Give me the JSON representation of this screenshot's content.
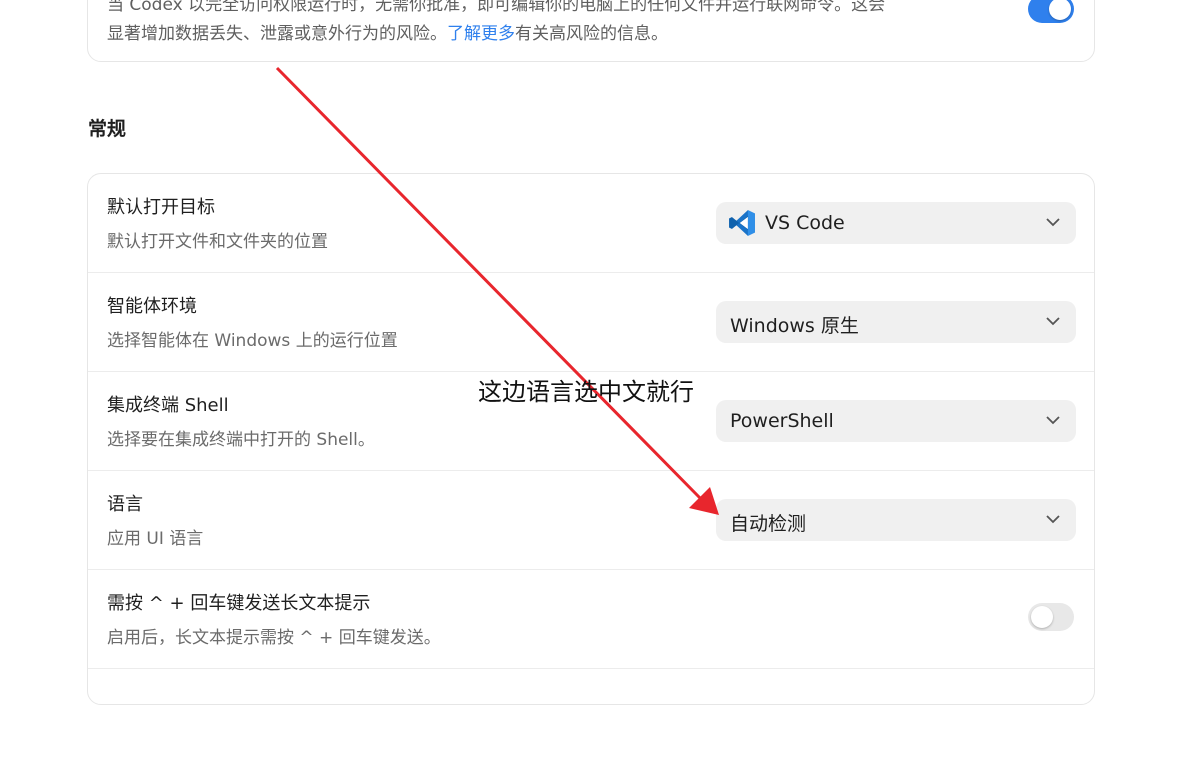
{
  "top_card": {
    "description_line1": "当 Codex 以完全访问权限运行时，无需你批准，即可编辑你的电脑上的任何文件并运行联网命令。这会",
    "description_line2_prefix": "显著增加数据丢失、泄露或意外行为的风险。",
    "learn_more_link": "了解更多",
    "description_line2_suffix": "有关高风险的信息。",
    "toggle_state": "on"
  },
  "section": {
    "heading": "常规"
  },
  "settings": {
    "default_open_target": {
      "title": "默认打开目标",
      "description": "默认打开文件和文件夹的位置",
      "value": "VS Code",
      "icon": "vscode-icon"
    },
    "agent_environment": {
      "title": "智能体环境",
      "description": "选择智能体在 Windows 上的运行位置",
      "value": "Windows 原生"
    },
    "integrated_terminal_shell": {
      "title": "集成终端 Shell",
      "description": "选择要在集成终端中打开的 Shell。",
      "value": "PowerShell"
    },
    "language": {
      "title": "语言",
      "description": "应用 UI 语言",
      "value": "自动检测"
    },
    "ctrl_enter_long_prompt": {
      "title": "需按 ^ + 回车键发送长文本提示",
      "description": "启用后，长文本提示需按 ^ + 回车键发送。",
      "toggle_state": "off"
    }
  },
  "annotation": {
    "text": "这边语言选中文就行",
    "arrow_color": "#e8262d"
  }
}
